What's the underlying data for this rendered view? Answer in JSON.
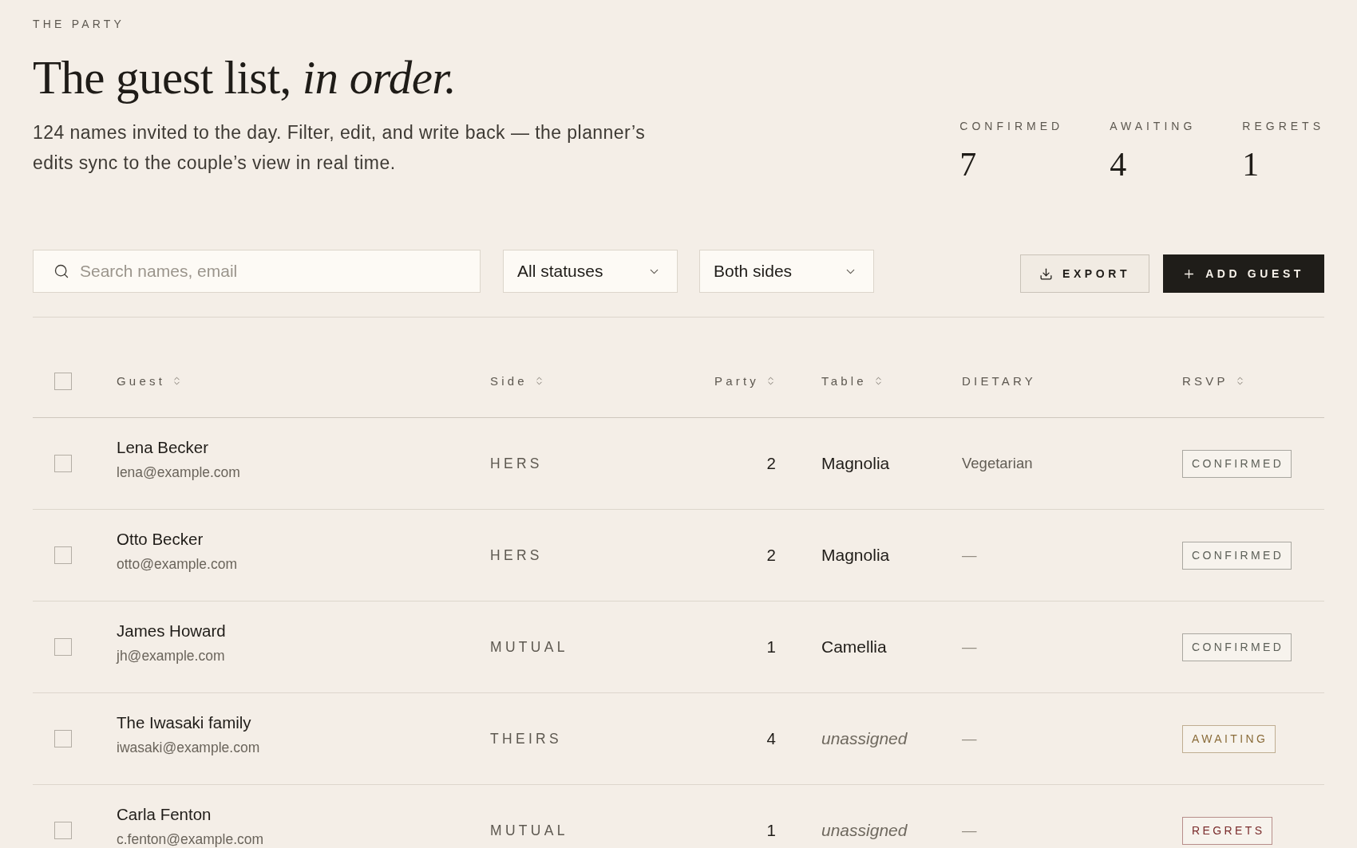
{
  "header": {
    "eyebrow": "THE PARTY",
    "title": "The guest list, *in order.*",
    "description": "124 names invited to the day. Filter, edit, and write back — the planner’s edits sync to the couple’s view in real time."
  },
  "stats": [
    {
      "label": "CONFIRMED",
      "value": "7"
    },
    {
      "label": "AWAITING",
      "value": "4"
    },
    {
      "label": "REGRETS",
      "value": "1"
    }
  ],
  "toolbar": {
    "search": {
      "placeholder": "Search names, email"
    },
    "filters": [
      {
        "value": "All statuses"
      },
      {
        "value": "Both sides"
      }
    ],
    "buttons": [
      {
        "kind": "secondary",
        "label": "EXPORT"
      },
      {
        "kind": "primary",
        "label": "ADD GUEST"
      }
    ]
  },
  "table": {
    "select_all": {
      "checked": false
    },
    "columns": [
      {
        "label": "Guest",
        "sortable": true
      },
      {
        "label": "Side",
        "sortable": true
      },
      {
        "label": "Party",
        "sortable": true
      },
      {
        "label": "Table",
        "sortable": true
      },
      {
        "label": "DIETARY",
        "sortable": false
      },
      {
        "label": "RSVP",
        "sortable": true
      }
    ],
    "rows": [
      {
        "checked": false,
        "name": "Lena Becker",
        "email": "lena@example.com",
        "side": "HERS",
        "party": "2",
        "table": {
          "text": "Magnolia",
          "assigned": true
        },
        "dietary": {
          "text": "Vegetarian",
          "specified": true
        },
        "rsvp": {
          "label": "CONFIRMED",
          "color": "#5d6058"
        }
      },
      {
        "checked": false,
        "name": "Otto Becker",
        "email": "otto@example.com",
        "side": "HERS",
        "party": "2",
        "table": {
          "text": "Magnolia",
          "assigned": true
        },
        "dietary": {
          "text": "—",
          "specified": false
        },
        "rsvp": {
          "label": "CONFIRMED",
          "color": "#5d6058"
        }
      },
      {
        "checked": false,
        "name": "James Howard",
        "email": "jh@example.com",
        "side": "MUTUAL",
        "party": "1",
        "table": {
          "text": "Camellia",
          "assigned": true
        },
        "dietary": {
          "text": "—",
          "specified": false
        },
        "rsvp": {
          "label": "CONFIRMED",
          "color": "#5d6058"
        }
      },
      {
        "checked": false,
        "name": "The Iwasaki family",
        "email": "iwasaki@example.com",
        "side": "THEIRS",
        "party": "4",
        "table": {
          "text": "unassigned",
          "assigned": false
        },
        "dietary": {
          "text": "—",
          "specified": false
        },
        "rsvp": {
          "label": "AWAITING",
          "color": "#8a6c3a"
        }
      },
      {
        "checked": false,
        "name": "Carla Fenton",
        "email": "c.fenton@example.com",
        "side": "MUTUAL",
        "party": "1",
        "table": {
          "text": "unassigned",
          "assigned": false
        },
        "dietary": {
          "text": "—",
          "specified": false
        },
        "rsvp": {
          "label": "REGRETS",
          "color": "#7a2c2c"
        }
      }
    ]
  }
}
